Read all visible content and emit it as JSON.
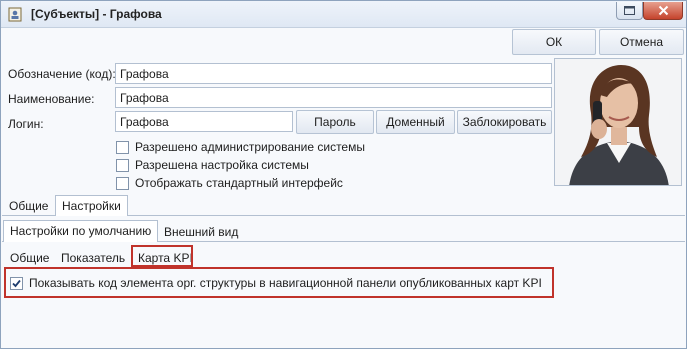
{
  "window": {
    "title": "[Субъекты] - Графова"
  },
  "toolbar": {
    "ok_label": "ОК",
    "cancel_label": "Отмена"
  },
  "form": {
    "code_label": "Обозначение (код):",
    "code_value": "Графова",
    "name_label": "Наименование:",
    "name_value": "Графова",
    "login_label": "Логин:",
    "login_value": "Графова",
    "password_button": "Пароль",
    "domain_button": "Доменный",
    "block_button": "Заблокировать"
  },
  "checkboxes": [
    {
      "label": "Разрешено администрирование системы",
      "checked": false
    },
    {
      "label": "Разрешена настройка системы",
      "checked": false
    },
    {
      "label": "Отображать стандартный интерфейс",
      "checked": false
    }
  ],
  "main_tabs": [
    "Общие",
    "Настройки"
  ],
  "settings_tabs": [
    "Настройки по умолчанию",
    "Внешний вид"
  ],
  "sub_tabs": [
    "Общие",
    "Показатель",
    "Карта KPI"
  ],
  "kpi_option": {
    "label": "Показывать код элемента орг. структуры в навигационной панели опубликованных карт KPI",
    "checked": true
  },
  "icons": [
    "app-icon",
    "restore-icon",
    "close-icon",
    "checkmark-icon"
  ],
  "colors": {
    "highlight": "#c0332b",
    "close_button": "#c5432c"
  }
}
